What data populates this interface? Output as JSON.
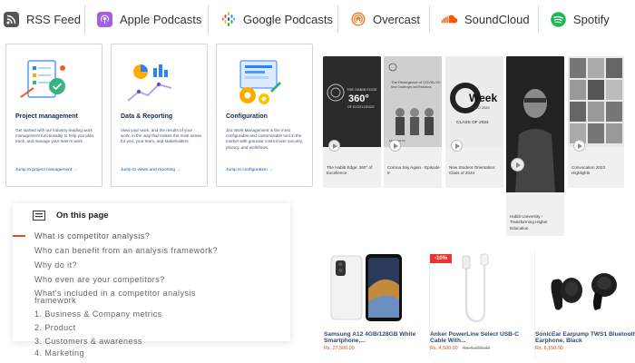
{
  "podcast_tabs": [
    {
      "label": "RSS Feed",
      "icon": "rss-icon",
      "color": "#555555"
    },
    {
      "label": "Apple Podcasts",
      "icon": "apple-podcasts-icon",
      "color": "#9b4de0"
    },
    {
      "label": "Google Podcasts",
      "icon": "google-podcasts-icon",
      "color": "#4285f4"
    },
    {
      "label": "Overcast",
      "icon": "overcast-icon",
      "color": "#f07b2a"
    },
    {
      "label": "SoundCloud",
      "icon": "soundcloud-icon",
      "color": "#ff5500"
    },
    {
      "label": "Spotify",
      "icon": "spotify-icon",
      "color": "#1db954"
    }
  ],
  "feature_cards": [
    {
      "title": "Project management",
      "desc": "Get started with our industry-leading work management functionality to help you plan, track, and manage your team's work.",
      "link": "Jump to project management →"
    },
    {
      "title": "Data & Reporting",
      "desc": "View your work, and the results of your work, in the way that makes the most sense for you, your team, and stakeholders.",
      "link": "Jump to views and reporting →"
    },
    {
      "title": "Configuration",
      "desc": "Jira Work Management is the most configurable and customizable tool in the market with granular control over security, privacy, and workflows.",
      "link": "Jump to configuration →"
    }
  ],
  "on_this_page": {
    "title": "On this page",
    "items": [
      "What is competitor analysis?",
      "Who can benefit from an analysis framework?",
      "Why do it?",
      "Who even are your competitors?",
      "What's included in a competitor analysis",
      "framework",
      "1. Business & Company metrics",
      "2. Product",
      "3. Customers & awareness"
    ],
    "tail": "4. Marketing"
  },
  "videos": [
    {
      "caption": "The Habib Edge: 360° of Excellence",
      "thumb_text_1": "THE HABIB EDGE",
      "thumb_text_2": "360°",
      "thumb_text_3": "OF EXCELLENCE"
    },
    {
      "caption": "Corona Say Again - Episode 9",
      "thumb_text_1": "The Resurgence of COVID-19:",
      "thumb_text_2": "New Challenges and Reactions",
      "thumb_text_3": "EPISODE 09"
    },
    {
      "caption": "New Student Orientation: Class of 2024",
      "thumb_text_1": "Week",
      "thumb_text_2": "NSO 2020",
      "thumb_text_3": "CLASS OF 2024"
    },
    {
      "caption": "Habib University - Transforming Higher Education",
      "thumb_text_1": "",
      "thumb_text_2": "",
      "thumb_text_3": ""
    },
    {
      "caption": "Convocation 2023 Highlights",
      "thumb_text_1": "",
      "thumb_text_2": "",
      "thumb_text_3": ""
    }
  ],
  "products": [
    {
      "title": "Samsung A12 4GB/128GB White Smartphone,...",
      "price": "Rs. 27,500.00",
      "old_price": "",
      "badge": ""
    },
    {
      "title": "Anker PowerLine Select USB-C Cable With...",
      "price": "Rs. 4,500.00",
      "old_price": "Rs. 5,000.00",
      "badge": "-10%"
    },
    {
      "title": "SonicEar Earpump TWS1 Bluetooth Earphone, Black",
      "price": "Rs. 6,150.00",
      "old_price": "",
      "badge": ""
    }
  ]
}
